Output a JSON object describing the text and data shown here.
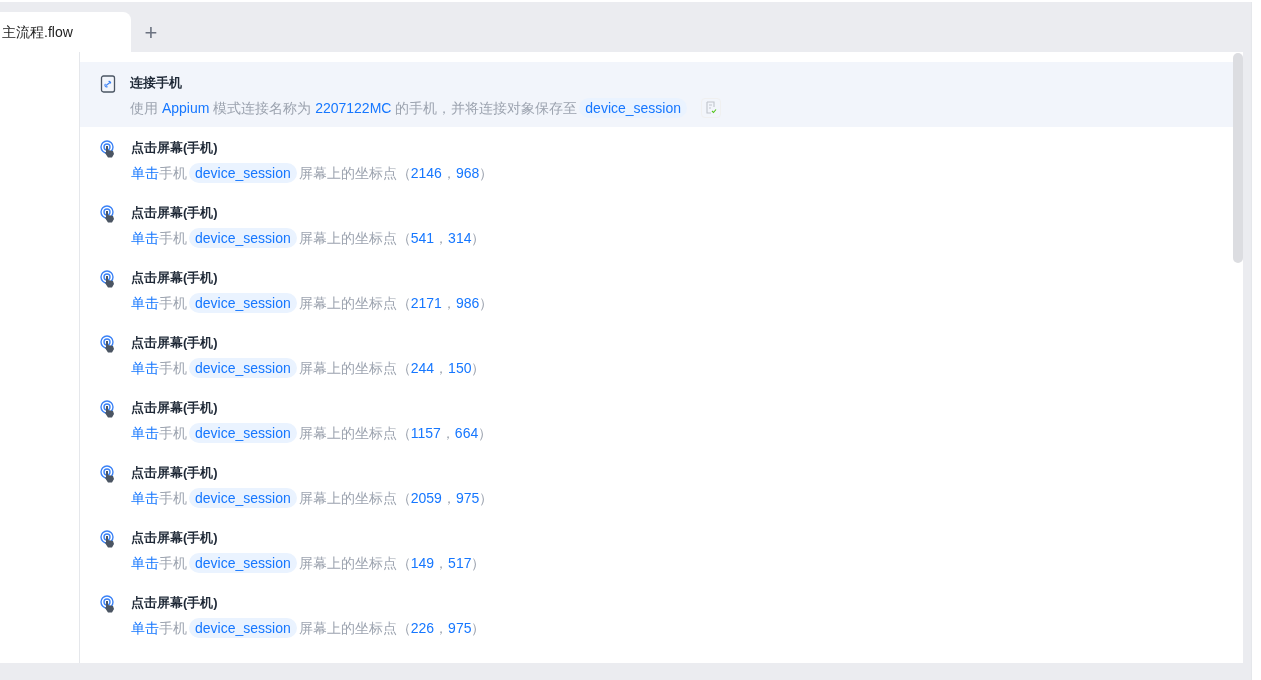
{
  "tabs": [
    {
      "label": "主流程.flow",
      "selected": true
    }
  ],
  "add_tab": "+",
  "steps": [
    {
      "kind": "connect",
      "selected": true,
      "title": "连接手机",
      "parts": [
        {
          "kind": "plain",
          "text": "使用 "
        },
        {
          "kind": "link",
          "text": "Appium"
        },
        {
          "kind": "plain",
          "text": " 模式连接名称为 "
        },
        {
          "kind": "link",
          "text": "2207122MC"
        },
        {
          "kind": "plain",
          "text": " 的手机，并将连接对象保存至"
        },
        {
          "kind": "var",
          "text": "device_session"
        }
      ]
    },
    {
      "kind": "tap",
      "selected": false,
      "title": "点击屏幕(手机)",
      "parts": [
        {
          "kind": "link",
          "text": "单击"
        },
        {
          "kind": "plain",
          "text": "手机"
        },
        {
          "kind": "var",
          "text": "device_session"
        },
        {
          "kind": "plain",
          "text": "屏幕上的坐标点（"
        },
        {
          "kind": "link",
          "text": "2146"
        },
        {
          "kind": "plain",
          "text": "，"
        },
        {
          "kind": "link",
          "text": "968"
        },
        {
          "kind": "plain",
          "text": "）"
        }
      ]
    },
    {
      "kind": "tap",
      "selected": false,
      "title": "点击屏幕(手机)",
      "parts": [
        {
          "kind": "link",
          "text": "单击"
        },
        {
          "kind": "plain",
          "text": "手机"
        },
        {
          "kind": "var",
          "text": "device_session"
        },
        {
          "kind": "plain",
          "text": "屏幕上的坐标点（"
        },
        {
          "kind": "link",
          "text": "541"
        },
        {
          "kind": "plain",
          "text": "，"
        },
        {
          "kind": "link",
          "text": "314"
        },
        {
          "kind": "plain",
          "text": "）"
        }
      ]
    },
    {
      "kind": "tap",
      "selected": false,
      "title": "点击屏幕(手机)",
      "parts": [
        {
          "kind": "link",
          "text": "单击"
        },
        {
          "kind": "plain",
          "text": "手机"
        },
        {
          "kind": "var",
          "text": "device_session"
        },
        {
          "kind": "plain",
          "text": "屏幕上的坐标点（"
        },
        {
          "kind": "link",
          "text": "2171"
        },
        {
          "kind": "plain",
          "text": "，"
        },
        {
          "kind": "link",
          "text": "986"
        },
        {
          "kind": "plain",
          "text": "）"
        }
      ]
    },
    {
      "kind": "tap",
      "selected": false,
      "title": "点击屏幕(手机)",
      "parts": [
        {
          "kind": "link",
          "text": "单击"
        },
        {
          "kind": "plain",
          "text": "手机"
        },
        {
          "kind": "var",
          "text": "device_session"
        },
        {
          "kind": "plain",
          "text": "屏幕上的坐标点（"
        },
        {
          "kind": "link",
          "text": "244"
        },
        {
          "kind": "plain",
          "text": "，"
        },
        {
          "kind": "link",
          "text": "150"
        },
        {
          "kind": "plain",
          "text": "）"
        }
      ]
    },
    {
      "kind": "tap",
      "selected": false,
      "title": "点击屏幕(手机)",
      "parts": [
        {
          "kind": "link",
          "text": "单击"
        },
        {
          "kind": "plain",
          "text": "手机"
        },
        {
          "kind": "var",
          "text": "device_session"
        },
        {
          "kind": "plain",
          "text": "屏幕上的坐标点（"
        },
        {
          "kind": "link",
          "text": "1157"
        },
        {
          "kind": "plain",
          "text": "，"
        },
        {
          "kind": "link",
          "text": "664"
        },
        {
          "kind": "plain",
          "text": "）"
        }
      ]
    },
    {
      "kind": "tap",
      "selected": false,
      "title": "点击屏幕(手机)",
      "parts": [
        {
          "kind": "link",
          "text": "单击"
        },
        {
          "kind": "plain",
          "text": "手机"
        },
        {
          "kind": "var",
          "text": "device_session"
        },
        {
          "kind": "plain",
          "text": "屏幕上的坐标点（"
        },
        {
          "kind": "link",
          "text": "2059"
        },
        {
          "kind": "plain",
          "text": "，"
        },
        {
          "kind": "link",
          "text": "975"
        },
        {
          "kind": "plain",
          "text": "）"
        }
      ]
    },
    {
      "kind": "tap",
      "selected": false,
      "title": "点击屏幕(手机)",
      "parts": [
        {
          "kind": "link",
          "text": "单击"
        },
        {
          "kind": "plain",
          "text": "手机"
        },
        {
          "kind": "var",
          "text": "device_session"
        },
        {
          "kind": "plain",
          "text": "屏幕上的坐标点（"
        },
        {
          "kind": "link",
          "text": "149"
        },
        {
          "kind": "plain",
          "text": "，"
        },
        {
          "kind": "link",
          "text": "517"
        },
        {
          "kind": "plain",
          "text": "）"
        }
      ]
    },
    {
      "kind": "tap",
      "selected": false,
      "title": "点击屏幕(手机)",
      "parts": [
        {
          "kind": "link",
          "text": "单击"
        },
        {
          "kind": "plain",
          "text": "手机"
        },
        {
          "kind": "var",
          "text": "device_session"
        },
        {
          "kind": "plain",
          "text": "屏幕上的坐标点（"
        },
        {
          "kind": "link",
          "text": "226"
        },
        {
          "kind": "plain",
          "text": "，"
        },
        {
          "kind": "link",
          "text": "975"
        },
        {
          "kind": "plain",
          "text": "）"
        }
      ]
    }
  ]
}
